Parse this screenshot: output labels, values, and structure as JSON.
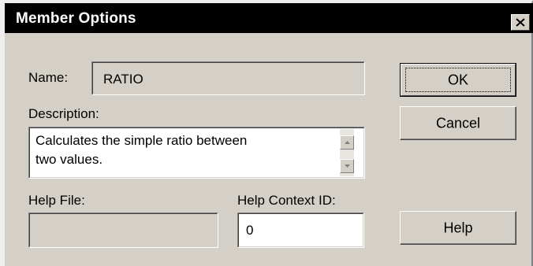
{
  "window": {
    "title": "Member Options",
    "close_label": "×"
  },
  "form": {
    "name_label": "Name:",
    "name_value": "RATIO",
    "description_label": "Description:",
    "description_line1": "Calculates the simple ratio between",
    "description_line2": "two values.",
    "help_file_label": "Help File:",
    "help_file_value": "",
    "help_context_label": "Help Context ID:",
    "help_context_value": "0"
  },
  "buttons": {
    "ok_label": "OK",
    "cancel_label": "Cancel",
    "help_label": "Help"
  },
  "icons": {
    "close": "close-icon",
    "scroll_up": "arrow-up-icon",
    "scroll_down": "arrow-down-icon"
  },
  "colors": {
    "title_bar": "#000000",
    "dialog_face": "#d4d0c8",
    "field_white": "#ffffff"
  }
}
